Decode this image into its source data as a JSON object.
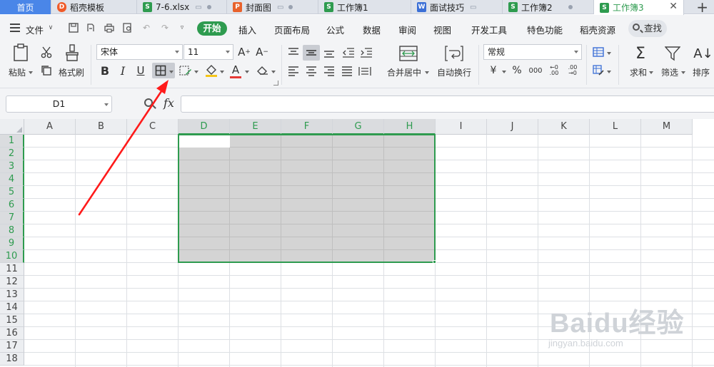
{
  "tabs": [
    {
      "label": "首页",
      "type": "home"
    },
    {
      "label": "稻壳模板",
      "icon": "docer-icon"
    },
    {
      "label": "7-6.xlsx",
      "icon": "sheet-icon"
    },
    {
      "label": "封面图",
      "icon": "ppt-icon"
    },
    {
      "label": "工作簿1",
      "icon": "sheet-icon"
    },
    {
      "label": "面试技巧",
      "icon": "word-icon"
    },
    {
      "label": "工作簿2",
      "icon": "sheet-icon"
    },
    {
      "label": "工作簿3",
      "icon": "sheet-icon",
      "active": true
    }
  ],
  "tab_icon_letters": {
    "sheet": "S",
    "ppt": "P",
    "word": "W",
    "docer": "D"
  },
  "menu": {
    "file_label": "文件",
    "start_label": "开始",
    "items": [
      "插入",
      "页面布局",
      "公式",
      "数据",
      "审阅",
      "视图",
      "开发工具",
      "特色功能",
      "稻壳资源"
    ],
    "search_label": "查找"
  },
  "ribbon": {
    "paste_label": "粘贴",
    "format_painter_label": "格式刷",
    "font_name": "宋体",
    "font_size": "11",
    "bold": "B",
    "italic": "I",
    "underline": "U",
    "merge_label": "合并居中",
    "wrap_label": "自动换行",
    "number_format": "常规",
    "currency_symbol": "¥",
    "percent_symbol": "%",
    "thousands_symbol": "000",
    "sum_label": "求和",
    "filter_label": "筛选",
    "sort_label": "排序",
    "font_color": "#e53935",
    "accent": "#2e9b4f"
  },
  "formula_bar": {
    "name_box": "D1",
    "fx_label": "fx",
    "content": ""
  },
  "grid": {
    "columns": [
      "A",
      "B",
      "C",
      "D",
      "E",
      "F",
      "G",
      "H",
      "I",
      "J",
      "K",
      "L",
      "M"
    ],
    "rows": [
      "1",
      "2",
      "3",
      "4",
      "5",
      "6",
      "7",
      "8",
      "9",
      "10",
      "11",
      "12",
      "13",
      "14",
      "15",
      "16",
      "17",
      "18"
    ],
    "selected_columns": [
      "D",
      "E",
      "F",
      "G",
      "H"
    ],
    "selected_rows": [
      "1",
      "2",
      "3",
      "4",
      "5",
      "6",
      "7",
      "8",
      "9",
      "10"
    ],
    "selection_range": "D1:H10",
    "active_cell": "D1"
  },
  "watermark": {
    "main": "Baidu经验",
    "sub": "jingyan.baidu.com"
  }
}
